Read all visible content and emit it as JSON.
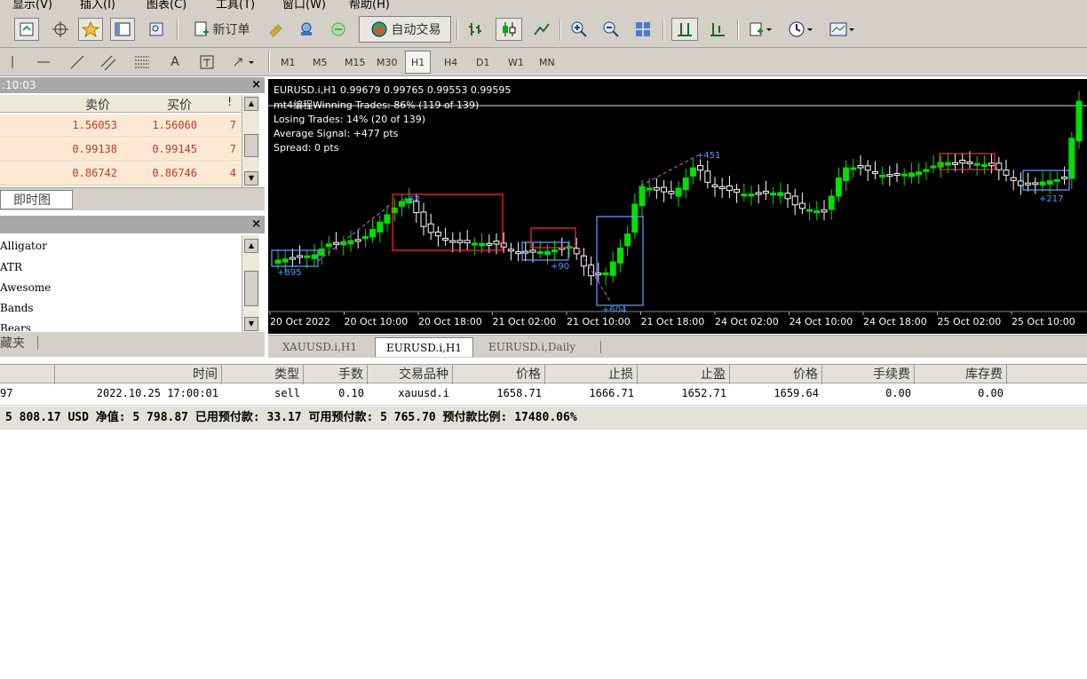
{
  "menu": [
    "显示(V)",
    "插入(I)",
    "图表(C)",
    "工具(T)",
    "窗口(W)",
    "帮助(H)"
  ],
  "toolbar": {
    "new_order_label": "新订单",
    "auto_trade_label": "自动交易"
  },
  "timeframes": [
    "M1",
    "M5",
    "M15",
    "M30",
    "H1",
    "H4",
    "D1",
    "W1",
    "MN"
  ],
  "active_timeframe": "H1",
  "market_watch": {
    "time": ":10:03",
    "columns": [
      "卖价",
      "买价",
      "!"
    ],
    "rows": [
      {
        "bid": "1.56053",
        "ask": "1.56060",
        "spread": "7"
      },
      {
        "bid": "0.99138",
        "ask": "0.99145",
        "spread": "7"
      },
      {
        "bid": "0.86742",
        "ask": "0.86746",
        "spread": "4"
      }
    ],
    "tab_label": "即时图"
  },
  "navigator": {
    "items": [
      "Alligator",
      "ATR",
      "Awesome",
      "Bands",
      "Bears"
    ],
    "tab_label": "藏夹"
  },
  "chart": {
    "header": "EURUSD.i,H1  0.99679 0.99765 0.99553 0.99595",
    "stats": [
      "mt4编程Winning Trades: 86% (119 of 139)",
      "Losing Trades: 14% (20 of 139)",
      "Average Signal: +477 pts",
      "Spread: 0 pts"
    ],
    "x_labels": [
      "20 Oct 2022",
      "20 Oct 10:00",
      "20 Oct 18:00",
      "21 Oct 02:00",
      "21 Oct 10:00",
      "21 Oct 18:00",
      "24 Oct 02:00",
      "24 Oct 10:00",
      "24 Oct 18:00",
      "25 Oct 02:00",
      "25 Oct 10:00"
    ],
    "annotations": [
      "+895",
      "+67",
      "+90",
      "+451",
      "+217",
      "+604"
    ],
    "colors": {
      "bull": "#00e000",
      "bear": "#ffffff",
      "win_box": "#6ba0ff",
      "loss_box": "#ff3030",
      "dashed": "#c050c0",
      "label": "#4aa0ff"
    }
  },
  "chart_tabs": [
    "XAUUSD.i,H1",
    "EURUSD.i,H1",
    "EURUSD.i,Daily"
  ],
  "active_chart_tab": "EURUSD.i,H1",
  "terminal": {
    "columns": [
      "时间",
      "类型",
      "手数",
      "交易品种",
      "价格",
      "止损",
      "止盈",
      "价格",
      "手续费",
      "库存费"
    ],
    "row": {
      "order": "97",
      "time": "2022.10.25 17:00:01",
      "type": "sell",
      "lots": "0.10",
      "symbol": "xauusd.i",
      "open_price": "1658.71",
      "sl": "1666.71",
      "tp": "1652.71",
      "price": "1659.64",
      "commission": "0.00",
      "swap": "0.00"
    },
    "balance_line": "5 808.17 USD  净值: 5 798.87  已用预付款: 33.17  可用预付款: 5 765.70  预付款比例: 17480.06%"
  }
}
